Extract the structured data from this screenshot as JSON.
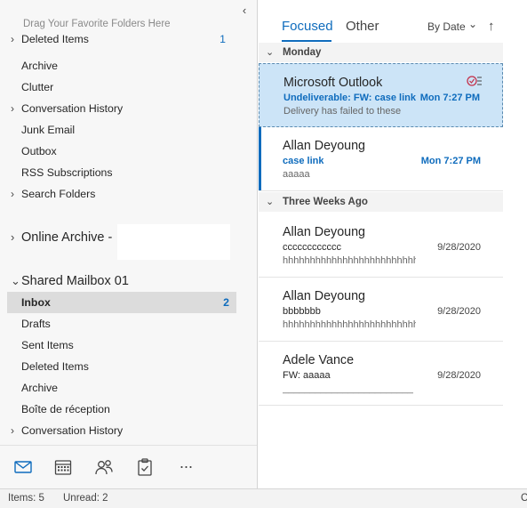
{
  "folder_pane": {
    "drag_hint": "Drag Your Favorite Folders Here",
    "collapse_glyph": "‹",
    "top_folders": [
      {
        "label": "Deleted Items",
        "count": "1"
      },
      {
        "label": "Archive"
      },
      {
        "label": "Clutter"
      },
      {
        "label": "Conversation History"
      },
      {
        "label": "Junk Email"
      },
      {
        "label": "Outbox"
      },
      {
        "label": "RSS Subscriptions"
      },
      {
        "label": "Search Folders"
      }
    ],
    "online_archive": {
      "label": "Online Archive -"
    },
    "shared_mailbox": {
      "label": "Shared Mailbox 01",
      "folders": [
        {
          "label": "Inbox",
          "count": "2"
        },
        {
          "label": "Drafts"
        },
        {
          "label": "Sent Items"
        },
        {
          "label": "Deleted Items"
        },
        {
          "label": "Archive"
        },
        {
          "label": "Boîte de réception"
        },
        {
          "label": "Conversation History"
        }
      ]
    },
    "nav": [
      "mail-icon",
      "calendar-icon",
      "people-icon",
      "tasks-icon",
      "more-icon"
    ],
    "more_glyph": "···"
  },
  "message_list": {
    "tabs": {
      "focused": "Focused",
      "other": "Other"
    },
    "sort": {
      "label": "By Date",
      "chevron": "⌄",
      "direction_glyph": "↑"
    },
    "groups": [
      {
        "label": "Monday",
        "messages": [
          {
            "sender": "Microsoft Outlook",
            "subject": "Undeliverable: FW: case link",
            "preview": "Delivery has failed to these",
            "date": "Mon 7:27 PM"
          },
          {
            "sender": "Allan Deyoung",
            "subject": "case link",
            "preview": "aaaaa",
            "date": "Mon 7:27 PM"
          }
        ]
      },
      {
        "label": "Three Weeks Ago",
        "messages": [
          {
            "sender": "Allan Deyoung",
            "subject": "cccccccccccc",
            "preview": "hhhhhhhhhhhhhhhhhhhhhhhhh",
            "date": "9/28/2020"
          },
          {
            "sender": "Allan Deyoung",
            "subject": "bbbbbbb",
            "preview": "hhhhhhhhhhhhhhhhhhhhhhhhh",
            "date": "9/28/2020"
          },
          {
            "sender": "Adele Vance",
            "subject": "FW: aaaaa",
            "preview": "________________________",
            "date": "9/28/2020"
          }
        ]
      }
    ]
  },
  "status_bar": {
    "items": "Items: 5",
    "unread": "Unread: 2",
    "edge": "C"
  },
  "colors": {
    "accent": "#0f6cbd",
    "selected_bg": "#cce4f7",
    "pane_bg": "#f7f7f7"
  }
}
